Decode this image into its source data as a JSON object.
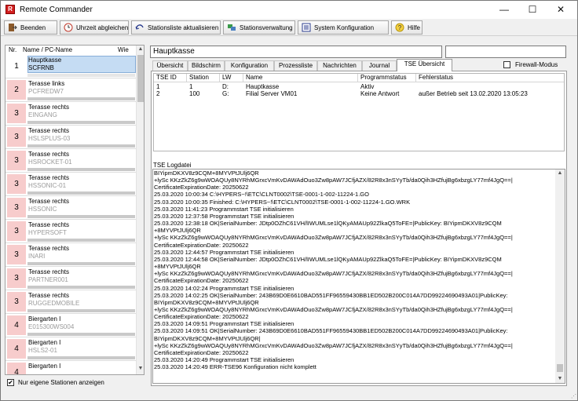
{
  "window": {
    "title": "Remote Commander",
    "icon": "app-icon",
    "controls": {
      "minimize": "—",
      "maximize": "☐",
      "close": "✕"
    }
  },
  "toolbar": {
    "buttons": [
      {
        "label": "Beenden",
        "icon": "exit-icon"
      },
      {
        "label": "Uhrzeit abgleichen",
        "icon": "clock-sync-icon"
      },
      {
        "label": "Stationsliste aktualisieren",
        "icon": "refresh-icon"
      },
      {
        "label": "Stationsverwaltung",
        "icon": "stations-icon"
      },
      {
        "label": "System Konfiguration",
        "icon": "config-icon"
      },
      {
        "label": "Hilfe",
        "icon": "help-icon"
      }
    ]
  },
  "station_list": {
    "headers": {
      "nr": "Nr.",
      "name": "Name / PC-Name",
      "wie": "Wie"
    },
    "items": [
      {
        "nr": "1",
        "name": "Hauptkasse",
        "pc": "SCFRNB",
        "color": "#ffffff"
      },
      {
        "nr": "2",
        "name": "Terasse links",
        "pc": "PCFREDW7",
        "color": "#f7cccc"
      },
      {
        "nr": "3",
        "name": "Terasse rechts",
        "pc": "EINGANG",
        "color": "#f7cccc"
      },
      {
        "nr": "3",
        "name": "Terasse rechts",
        "pc": "HSLSPLUS-03",
        "color": "#f7cccc"
      },
      {
        "nr": "3",
        "name": "Terasse rechts",
        "pc": "HSROCKET-01",
        "color": "#f7cccc"
      },
      {
        "nr": "3",
        "name": "Terasse rechts",
        "pc": "HSSONIC-01",
        "color": "#f7cccc"
      },
      {
        "nr": "3",
        "name": "Terasse rechts",
        "pc": "HSSONIC",
        "color": "#f7cccc"
      },
      {
        "nr": "3",
        "name": "Terasse rechts",
        "pc": "HYPERSOFT",
        "color": "#f7cccc"
      },
      {
        "nr": "3",
        "name": "Terasse rechts",
        "pc": "INARI",
        "color": "#f7cccc"
      },
      {
        "nr": "3",
        "name": "Terasse rechts",
        "pc": "PARTNER001",
        "color": "#f7cccc"
      },
      {
        "nr": "3",
        "name": "Terasse rechts",
        "pc": "RUGGEDMOBILE",
        "color": "#f7cccc"
      },
      {
        "nr": "4",
        "name": "Biergarten I",
        "pc": "E015300WS004",
        "color": "#f7cccc"
      },
      {
        "nr": "4",
        "name": "Biergarten I",
        "pc": "HSLS2-01",
        "color": "#f7cccc"
      },
      {
        "nr": "4",
        "name": "Biergarten I",
        "pc": "",
        "color": "#f7cccc"
      }
    ],
    "own_only_label": "Nur eigene Stationen anzeigen",
    "own_only_checked": "✔"
  },
  "detail": {
    "station_title": "Hauptkasse",
    "tabs": [
      "Übersicht",
      "Bildschirm",
      "Konfiguration",
      "Prozessliste",
      "Nachrichten",
      "Journal",
      "TSE Übersicht"
    ],
    "active_tab": "TSE Übersicht",
    "firewall_label": "Firewall-Modus",
    "tse_table": {
      "columns": [
        "TSE ID",
        "Station",
        "LW",
        "Name",
        "Programmstatus",
        "Fehlerstatus"
      ],
      "rows": [
        [
          "1",
          "1",
          "D:",
          "Hauptkasse",
          "Aktiv",
          ""
        ],
        [
          "2",
          "100",
          "G:",
          "Filial Server VM01",
          "Keine Antwort",
          "außer Betrieb seit 13.02.2020 13:05:23"
        ]
      ]
    },
    "log_label": "TSE Logdatei",
    "log_lines": [
      "BIYipmDKXV8z9CQM+8MYVPtJUlj6QR",
      "+lySc KKzZkZ6g9wWOAQUy8NYRhMGrxcVmKvDAWAdOuo3Zw8pAW7JCfjAZX/82R8x3nSYyTb/da0Qih3HZfujBg6xbzgLY77mf4JgQ==|",
      "CertificateExpirationDate: 20250622",
      "25.03.2020 10:00:34 C:\\HYPERS~!\\ETC\\CLNT0002\\TSE-0001-1-002-11224-1.GO",
      "25.03.2020 10:00:35 Finished: C:\\HYPERS~!\\ETC\\CLNT0002\\TSE-0001-1-002-11224-1.GO.WRK",
      "25.03.2020 11:41:23 Programmstart TSE initialisieren",
      "25.03.2020 12:37:58 Programmstart TSE initialisieren",
      "25.03.2020 12:38:18 OK|SerialNumber: JDtp0OZhC61VH/lIWUMLse1lQKyAMAUp92ZlkaQ5ToFE=|PublicKey: BIYipmDKXV8z9CQM",
      "+8MYVPtJUlj6QR",
      "+lySc KKzZkZ6g9wWOAQUy8NYRhMGrxcVmKvDAWAdOuo3Zw8pAW7JCfjAZX/82R8x3nSYyTb/da0Qih3HZfujBg6xbzgLY77mf4JgQ==|",
      "CertificateExpirationDate: 20250622",
      "25.03.2020 12:44:57 Programmstart TSE initialisieren",
      "25.03.2020 12:44:58 OK|SerialNumber: JDtp0OZhC61VH/lIWUMLse1lQKyAMAUp92ZlkaQ5ToFE=|PublicKey: BIYipmDKXV8z9CQM",
      "+8MYVPtJUlj6QR",
      "+lySc KKzZkZ6g9wWOAQUy8NYRhMGrxcVmKvDAWAdOuo3Zw8pAW7JCfjAZX/82R8x3nSYyTb/da0Qih3HZfujBg6xbzgLY77mf4JgQ==|",
      "CertificateExpirationDate: 20250622",
      "25.03.2020 14:02:24 Programmstart TSE initialisieren",
      "25.03.2020 14:02:25 OK|SerialNumber: 243B69D0E6610BAD551FF96559430BB1ED502B200C014A7DD99224690493A01|PublicKey:",
      "BIYipmDKXV8z9CQM+8MYVPtJUlj6QR",
      "+lySc KKzZkZ6g9wWOAQUy8NYRhMGrxcVmKvDAWAdOuo3Zw8pAW7JCfjAZX/82R8x3nSYyTb/da0Qih3HZfujBg6xbzgLY77mf4JgQ==|",
      "CertificateExpirationDate: 20250622",
      "25.03.2020 14:09:51 Programmstart TSE initialisieren",
      "25.03.2020 14:09:51 OK|SerialNumber: 243B69D0E6610BAD551FF96559430BB1ED502B200C014A7DD99224690493A01|PublicKey:",
      "BIYipmDKXV8z9CQM+8MYVPtJUlj6QR|",
      "+lySc KKzZkZ6g9wWOAQUy8NYRhMGrxcVmKvDAWAdOuo3Zw8pAW7JCfjAZX/82R8x3nSYyTb/da0Qih3HZfujBg6xbzgLY77mf4JgQ==|",
      "CertificateExpirationDate: 20250622",
      "25.03.2020 14:20:49 Programmstart TSE initialisieren",
      "25.03.2020 14:20:49 ERR-TSE96 Konfiguration nicht komplett"
    ]
  }
}
